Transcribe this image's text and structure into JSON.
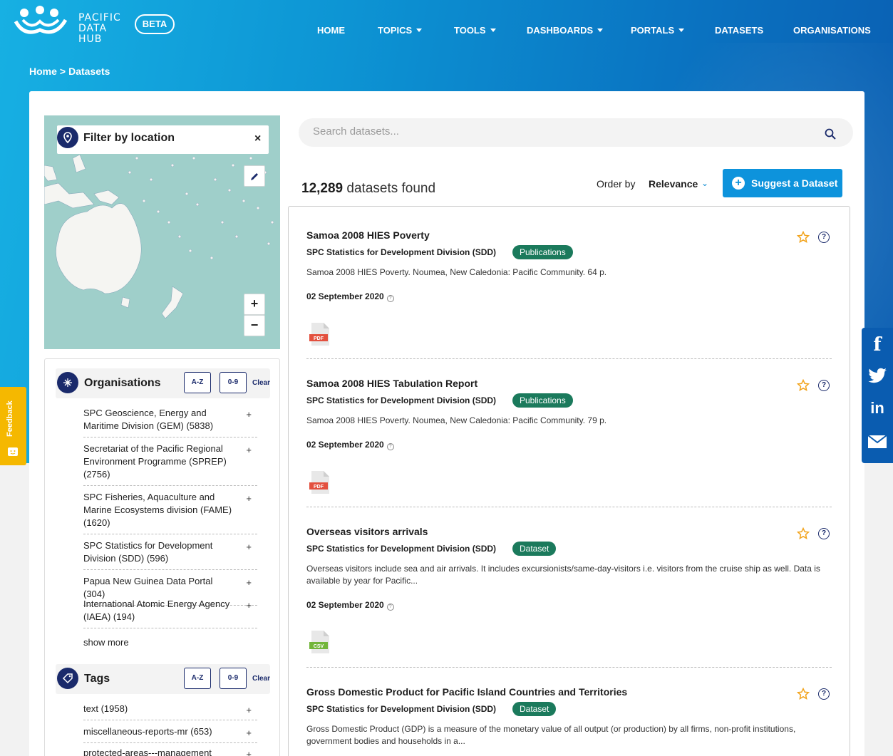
{
  "brand": {
    "logo_text_lines": [
      "PACIFIC",
      "DATA",
      "HUB"
    ],
    "beta_label": "BETA"
  },
  "nav": [
    {
      "label": "HOME",
      "dropdown": false
    },
    {
      "label": "TOPICS",
      "dropdown": true
    },
    {
      "label": "TOOLS",
      "dropdown": true
    },
    {
      "label": "DASHBOARDS",
      "dropdown": true
    },
    {
      "label": "PORTALS",
      "dropdown": true
    },
    {
      "label": "DATASETS",
      "dropdown": false
    },
    {
      "label": "ORGANISATIONS",
      "dropdown": false
    }
  ],
  "breadcrumb": {
    "home": "Home",
    "sep": ">",
    "current": "Datasets"
  },
  "map": {
    "title": "Filter by location",
    "close": "×",
    "zoom_in": "+",
    "zoom_out": "−"
  },
  "organisations": {
    "title": "Organisations",
    "sort_az": "A-Z",
    "sort_num": "0-9",
    "clear": "Clear",
    "items": [
      "SPC Geoscience, Energy and Maritime Division (GEM) (5838)",
      "Secretariat of the Pacific Regional Environment Programme (SPREP) (2756)",
      "SPC Fisheries, Aquaculture and Marine Ecosystems division (FAME) (1620)",
      "SPC Statistics for Development Division (SDD) (596)",
      "Papua New Guinea Data Portal (304)",
      "International Atomic Energy Agency (IAEA) (194)"
    ],
    "show_more": "show more"
  },
  "tags": {
    "title": "Tags",
    "sort_az": "A-Z",
    "sort_num": "0-9",
    "clear": "Clear",
    "items": [
      "text (1958)",
      "miscellaneous-reports-mr (653)",
      "protected-areas---management (564)"
    ]
  },
  "search": {
    "placeholder": "Search datasets..."
  },
  "results_count": {
    "number": "12,289",
    "suffix": " datasets found"
  },
  "order": {
    "label": "Order by",
    "value": "Relevance"
  },
  "suggest_button": "Suggest a Dataset",
  "datasets": [
    {
      "title": "Samoa 2008 HIES Poverty",
      "org": "SPC Statistics for Development Division (SDD)",
      "badge": "Publications",
      "description": "Samoa 2008 HIES Poverty. Noumea, New Caledonia: Pacific Community. 64 p.",
      "date": "02 September 2020",
      "file_type": "PDF",
      "file_color": "#e3503e"
    },
    {
      "title": "Samoa 2008 HIES Tabulation Report",
      "org": "SPC Statistics for Development Division (SDD)",
      "badge": "Publications",
      "description": "Samoa 2008 HIES Poverty. Noumea, New Caledonia: Pacific Community. 79 p.",
      "date": "02 September 2020",
      "file_type": "PDF",
      "file_color": "#e3503e"
    },
    {
      "title": "Overseas visitors arrivals",
      "org": "SPC Statistics for Development Division (SDD)",
      "badge": "Dataset",
      "description": "Overseas visitors include sea and air arrivals. It includes excursionists/same-day-visitors i.e. visitors from the cruise ship as well. Data is available by year for Pacific...",
      "date": "02 September 2020",
      "file_type": "CSV",
      "file_color": "#72b53a"
    },
    {
      "title": "Gross Domestic Product for Pacific Island Countries and Territories",
      "org": "SPC Statistics for Development Division (SDD)",
      "badge": "Dataset",
      "description": "Gross Domestic Product (GDP) is a measure of the monetary value of all output (or production) by all firms, non-profit institutions, government bodies and households in a...",
      "date": "",
      "file_type": "",
      "file_color": ""
    }
  ],
  "social": [
    "f",
    "twitter",
    "in",
    "mail"
  ],
  "feedback_label": "Feedback",
  "colors": {
    "navy": "#1a2a6b",
    "accent": "#0d93dc",
    "badge_green": "#1b7a5c",
    "star": "#f2a31b"
  }
}
